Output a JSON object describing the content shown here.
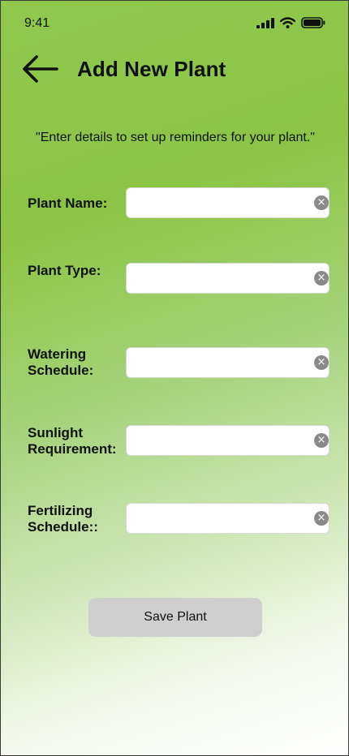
{
  "status_bar": {
    "time": "9:41"
  },
  "header": {
    "title": "Add New Plant",
    "back_icon": "arrow-left-icon"
  },
  "subtitle": "\"Enter details to set up reminders for your plant.\"",
  "fields": [
    {
      "label": "Plant Name:",
      "value": "",
      "placeholder": ""
    },
    {
      "label": "Plant Type:",
      "value": "",
      "placeholder": ""
    },
    {
      "label": "Watering\nSchedule:",
      "value": "",
      "placeholder": ""
    },
    {
      "label": "Sunlight\nRequirement:",
      "value": "",
      "placeholder": ""
    },
    {
      "label": "Fertilizing\n Schedule::",
      "value": "",
      "placeholder": ""
    }
  ],
  "actions": {
    "save_label": "Save Plant"
  },
  "colors": {
    "gradient_start": "#8cc545",
    "gradient_end": "#ffffff",
    "field_bg": "#ffffff",
    "clear_icon": "#8a8a8a",
    "button_bg": "#cfcfcf"
  },
  "icons": {
    "clear": "clear-circle-icon",
    "signal": "cellular-signal-icon",
    "wifi": "wifi-icon",
    "battery": "battery-icon"
  }
}
